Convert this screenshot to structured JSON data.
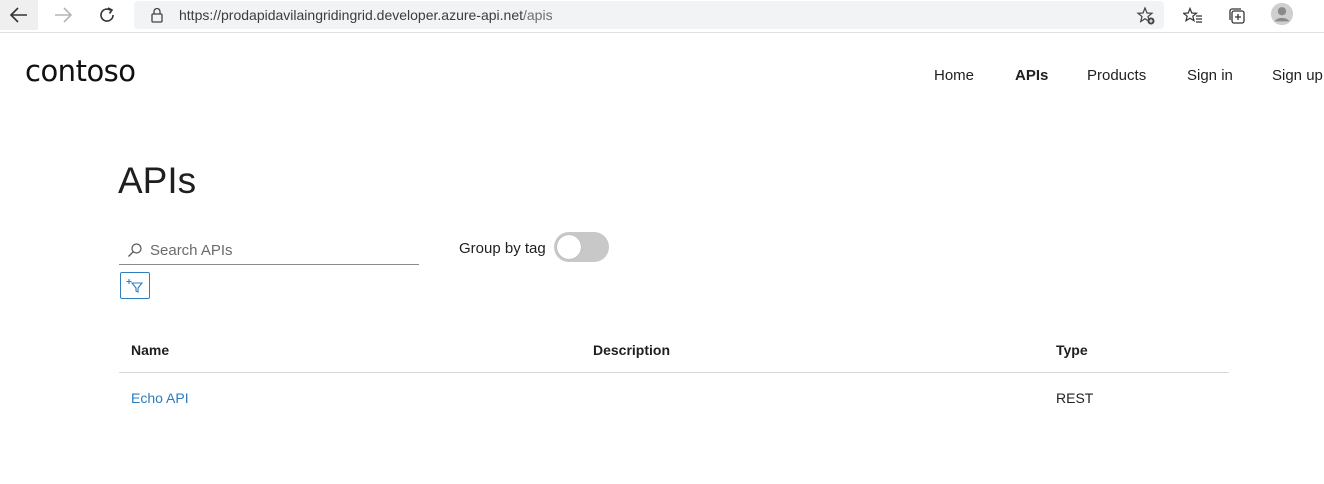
{
  "browser": {
    "url_host": "https://prodapidavilaingridingrid.developer.azure-api.net",
    "url_path": "/apis"
  },
  "site": {
    "logo": "contoso",
    "nav": [
      {
        "label": "Home",
        "active": false
      },
      {
        "label": "APIs",
        "active": true
      },
      {
        "label": "Products",
        "active": false
      },
      {
        "label": "Sign in",
        "active": false
      },
      {
        "label": "Sign up",
        "active": false
      }
    ]
  },
  "page": {
    "title": "APIs",
    "search": {
      "placeholder": "Search APIs",
      "value": ""
    },
    "group_by_tag": {
      "label": "Group by tag",
      "enabled": false
    }
  },
  "table": {
    "headers": {
      "name": "Name",
      "description": "Description",
      "type": "Type"
    },
    "rows": [
      {
        "name": "Echo API",
        "description": "",
        "type": "REST"
      }
    ]
  },
  "colors": {
    "link": "#2b7bbd",
    "toggle_off": "#c8c8c8"
  }
}
